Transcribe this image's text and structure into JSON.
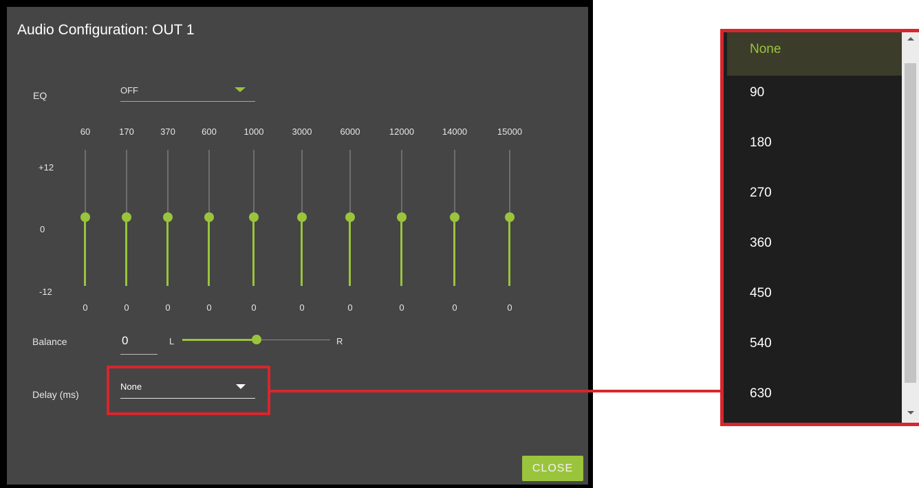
{
  "dialog": {
    "title": "Audio Configuration: OUT 1",
    "eq_label": "EQ",
    "eq_value": "OFF",
    "scale_top": "+12",
    "scale_mid": "0",
    "scale_bottom": "-12",
    "bands": [
      {
        "freq": "60",
        "value": "0"
      },
      {
        "freq": "170",
        "value": "0"
      },
      {
        "freq": "370",
        "value": "0"
      },
      {
        "freq": "600",
        "value": "0"
      },
      {
        "freq": "1000",
        "value": "0"
      },
      {
        "freq": "3000",
        "value": "0"
      },
      {
        "freq": "6000",
        "value": "0"
      },
      {
        "freq": "12000",
        "value": "0"
      },
      {
        "freq": "14000",
        "value": "0"
      },
      {
        "freq": "15000",
        "value": "0"
      }
    ],
    "balance_label": "Balance",
    "balance_value": "0",
    "balance_left": "L",
    "balance_right": "R",
    "delay_label": "Delay (ms)",
    "delay_value": "None",
    "close_label": "CLOSE"
  },
  "delay_dropdown": {
    "options": [
      "None",
      "90",
      "180",
      "270",
      "360",
      "450",
      "540",
      "630"
    ],
    "selected": "None"
  },
  "colors": {
    "accent": "#9ac43c",
    "highlight": "#d7262e",
    "panel": "#454545"
  }
}
